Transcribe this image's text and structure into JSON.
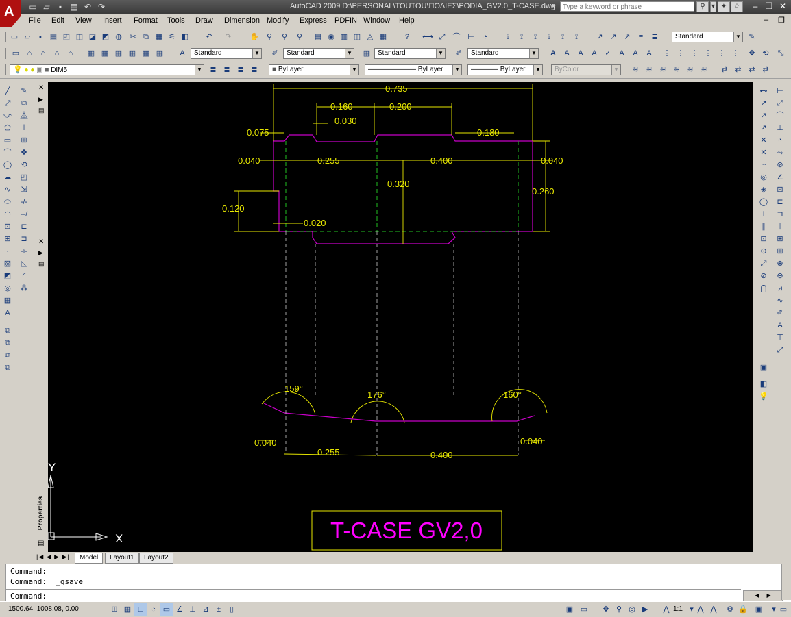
{
  "window": {
    "title": "AutoCAD 2009  D:\\PERSONAL\\TOUTOU\\ΠΟΔΙΕΣ\\PODIA_GV2.0_T-CASE.dwg",
    "search_placeholder": "Type a keyword or phrase"
  },
  "menu": [
    "File",
    "Edit",
    "View",
    "Insert",
    "Format",
    "Tools",
    "Draw",
    "Dimension",
    "Modify",
    "Express",
    "PDFIN",
    "Window",
    "Help"
  ],
  "toolbars": {
    "text_style": "Standard",
    "style2": "Standard",
    "style3": "Standard",
    "style4": "Standard",
    "style5": "Standard",
    "layer": "DIM5",
    "color": "ByLayer",
    "linetype": "ByLayer",
    "lineweight": "ByLayer",
    "plotstyle": "ByColor"
  },
  "drawing": {
    "dims": {
      "d0735": "0.735",
      "d0160": "0.160",
      "d0200": "0.200",
      "d0030": "0.030",
      "d0075": "0.075",
      "d0180": "0.180",
      "d0040a": "0.040",
      "d0255a": "0.255",
      "d0400a": "0.400",
      "d0040b": "0.040",
      "d0320": "0.320",
      "d0260": "0.260",
      "d0120": "0.120",
      "d0020": "0.020",
      "a159": "159°",
      "a176": "176°",
      "a160": "160°",
      "d0040c": "0.040",
      "d0255b": "0.255",
      "d0400b": "0.400",
      "d0040d": "0.040"
    },
    "label": "T-CASE GV2,0",
    "ucs_x": "X",
    "ucs_y": "Y",
    "colors": {
      "background": "#000000",
      "outline": "#d000d0",
      "dims": "#e8e800",
      "hidden": "#20c020",
      "label": "#ff00ff"
    }
  },
  "palette_title": "Properties",
  "layout_tabs": [
    "Model",
    "Layout1",
    "Layout2"
  ],
  "command": {
    "line1": "Command:",
    "line2": "Command:  _qsave",
    "prompt": "Command:"
  },
  "status": {
    "coords": "1500.64, 1008.08, 0.00",
    "scale": "1:1"
  }
}
